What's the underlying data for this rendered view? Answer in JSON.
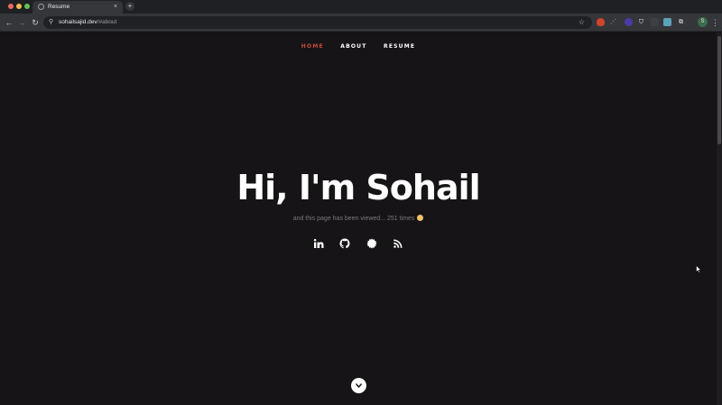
{
  "browser": {
    "tab_title": "Resume",
    "tab_close": "×",
    "new_tab": "+",
    "url_host": "sohailsajid.dev",
    "url_path": "/#about",
    "profile_initial": "S"
  },
  "nav": {
    "items": [
      {
        "label": "HOME",
        "active": true
      },
      {
        "label": "ABOUT",
        "active": false
      },
      {
        "label": "RESUME",
        "active": false
      }
    ]
  },
  "hero": {
    "title": "Hi, I'm Sohail",
    "subtitle": "and this page has been viewed... 251 times"
  },
  "socials": [
    {
      "icon": "linkedin-icon"
    },
    {
      "icon": "github-icon"
    },
    {
      "icon": "badge-icon"
    },
    {
      "icon": "rss-icon"
    }
  ],
  "colors": {
    "background": "#161416",
    "accent": "#c64a35",
    "text": "#ffffff",
    "muted": "#7a7878"
  }
}
